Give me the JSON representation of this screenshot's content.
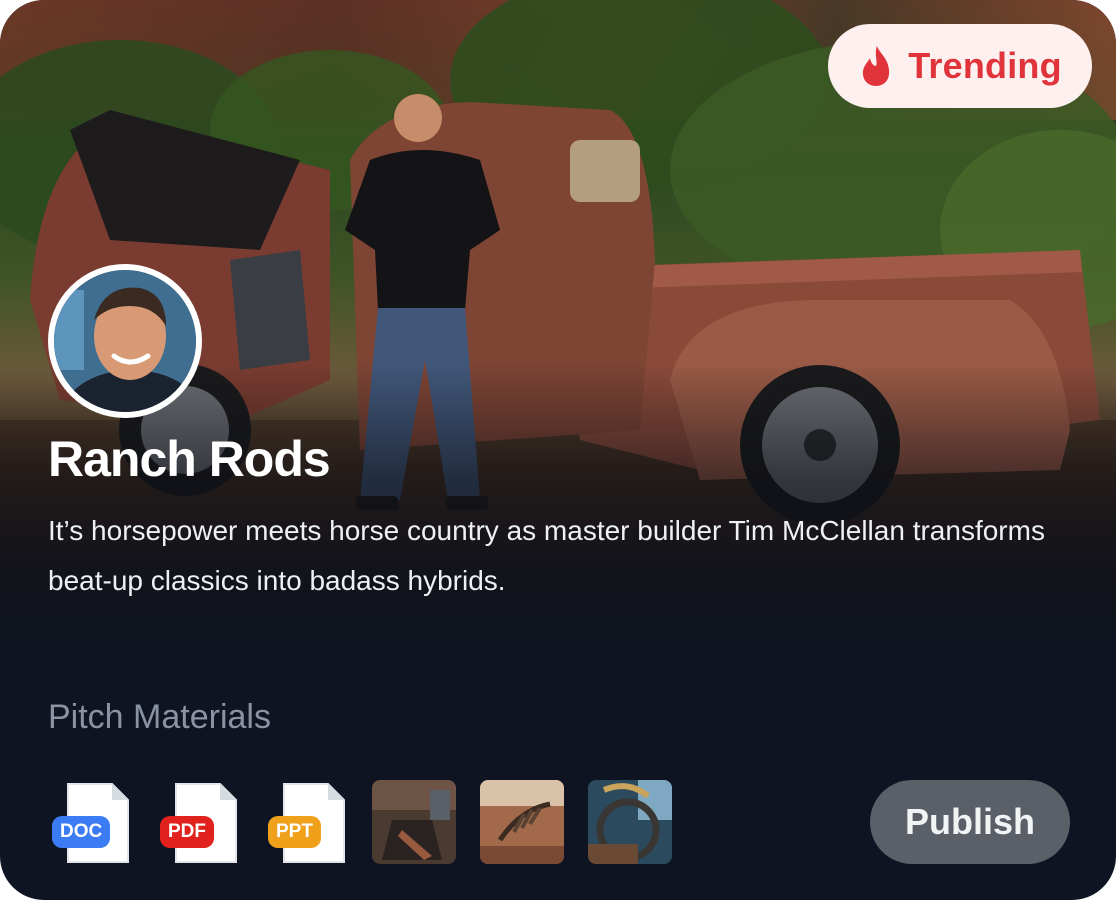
{
  "hero": {
    "badge": {
      "icon": "flame-icon",
      "label": "Trending",
      "color": "#e0333a"
    },
    "title": "Ranch Rods",
    "description": "It’s horsepower meets horse country as master builder Tim McClellan transforms beat-up classics into badass hybrids."
  },
  "materials": {
    "heading": "Pitch Materials",
    "files": [
      {
        "type": "DOC",
        "color": "#3b7cf5"
      },
      {
        "type": "PDF",
        "color": "#e0211d"
      },
      {
        "type": "PPT",
        "color": "#f0a11b"
      }
    ],
    "images": [
      "engine-bay-thumbnail",
      "skeleton-hand-thumbnail",
      "steering-wheel-thumbnail"
    ]
  },
  "actions": {
    "publish": "Publish"
  }
}
